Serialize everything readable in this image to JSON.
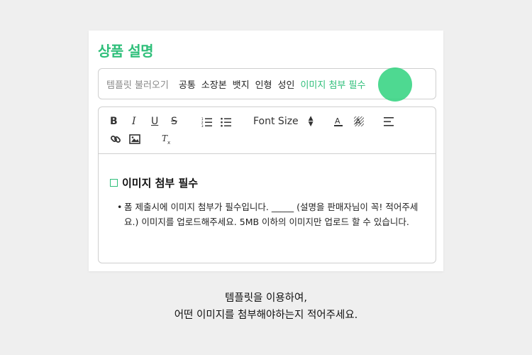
{
  "section": {
    "title": "상품 설명"
  },
  "template_bar": {
    "label": "템플릿 불러오기",
    "items": [
      "공통",
      "소장본",
      "뱃지",
      "인형",
      "성인",
      "이미지 첨부 필수"
    ],
    "active_index": 5,
    "accent_color": "#2fbf7a"
  },
  "toolbar": {
    "bold": "B",
    "italic": "I",
    "underline": "U",
    "strikethrough": "S",
    "font_size_label": "Font Size",
    "font_size_arrows": "⬍",
    "icons": [
      "bold-icon",
      "italic-icon",
      "underline-icon",
      "strikethrough-icon",
      "ordered-list-icon",
      "bullet-list-icon",
      "font-color-icon",
      "highlight-color-icon",
      "align-icon",
      "link-icon",
      "image-icon",
      "clear-format-icon"
    ]
  },
  "editor": {
    "heading": "이미지 첨부 필수",
    "bullet_text": "폼 제출시에 이미지 첨부가 필수입니다. _____ (설명을 판매자님이 꼭! 적어주세요.) 이미지를 업로드해주세요. 5MB 이하의 이미지만 업로드 할 수 있습니다."
  },
  "caption": {
    "line1": "템플릿을 이용하여,",
    "line2": "어떤 이미지를 첨부해야하는지 적어주세요."
  }
}
